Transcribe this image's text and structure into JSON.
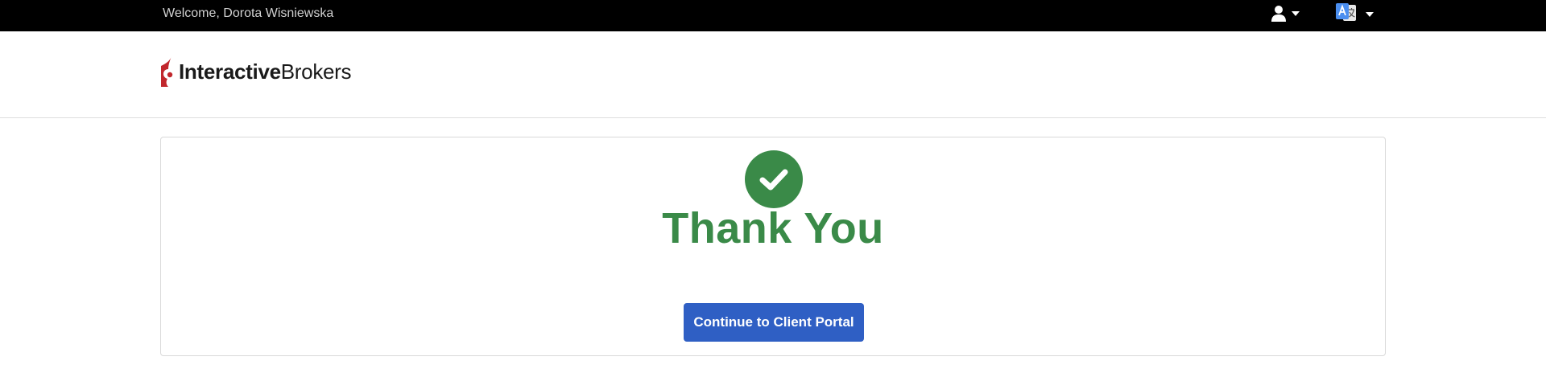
{
  "topbar": {
    "welcome_text": "Welcome, Dorota Wisniewska",
    "user_menu_icon": "user-icon",
    "language_menu_icon": "translate-icon"
  },
  "header": {
    "logo": {
      "name_bold": "Interactive",
      "name_regular": "Brokers",
      "mark_color": "#c1272d"
    }
  },
  "main": {
    "status_icon": "check-circle-icon",
    "title": "Thank You",
    "continue_button_label": "Continue to Client Portal"
  },
  "colors": {
    "topbar_bg": "#000000",
    "success_green": "#3a8a48",
    "primary_blue": "#2f5fc4",
    "translate_icon_blue": "#4a8ef0"
  }
}
